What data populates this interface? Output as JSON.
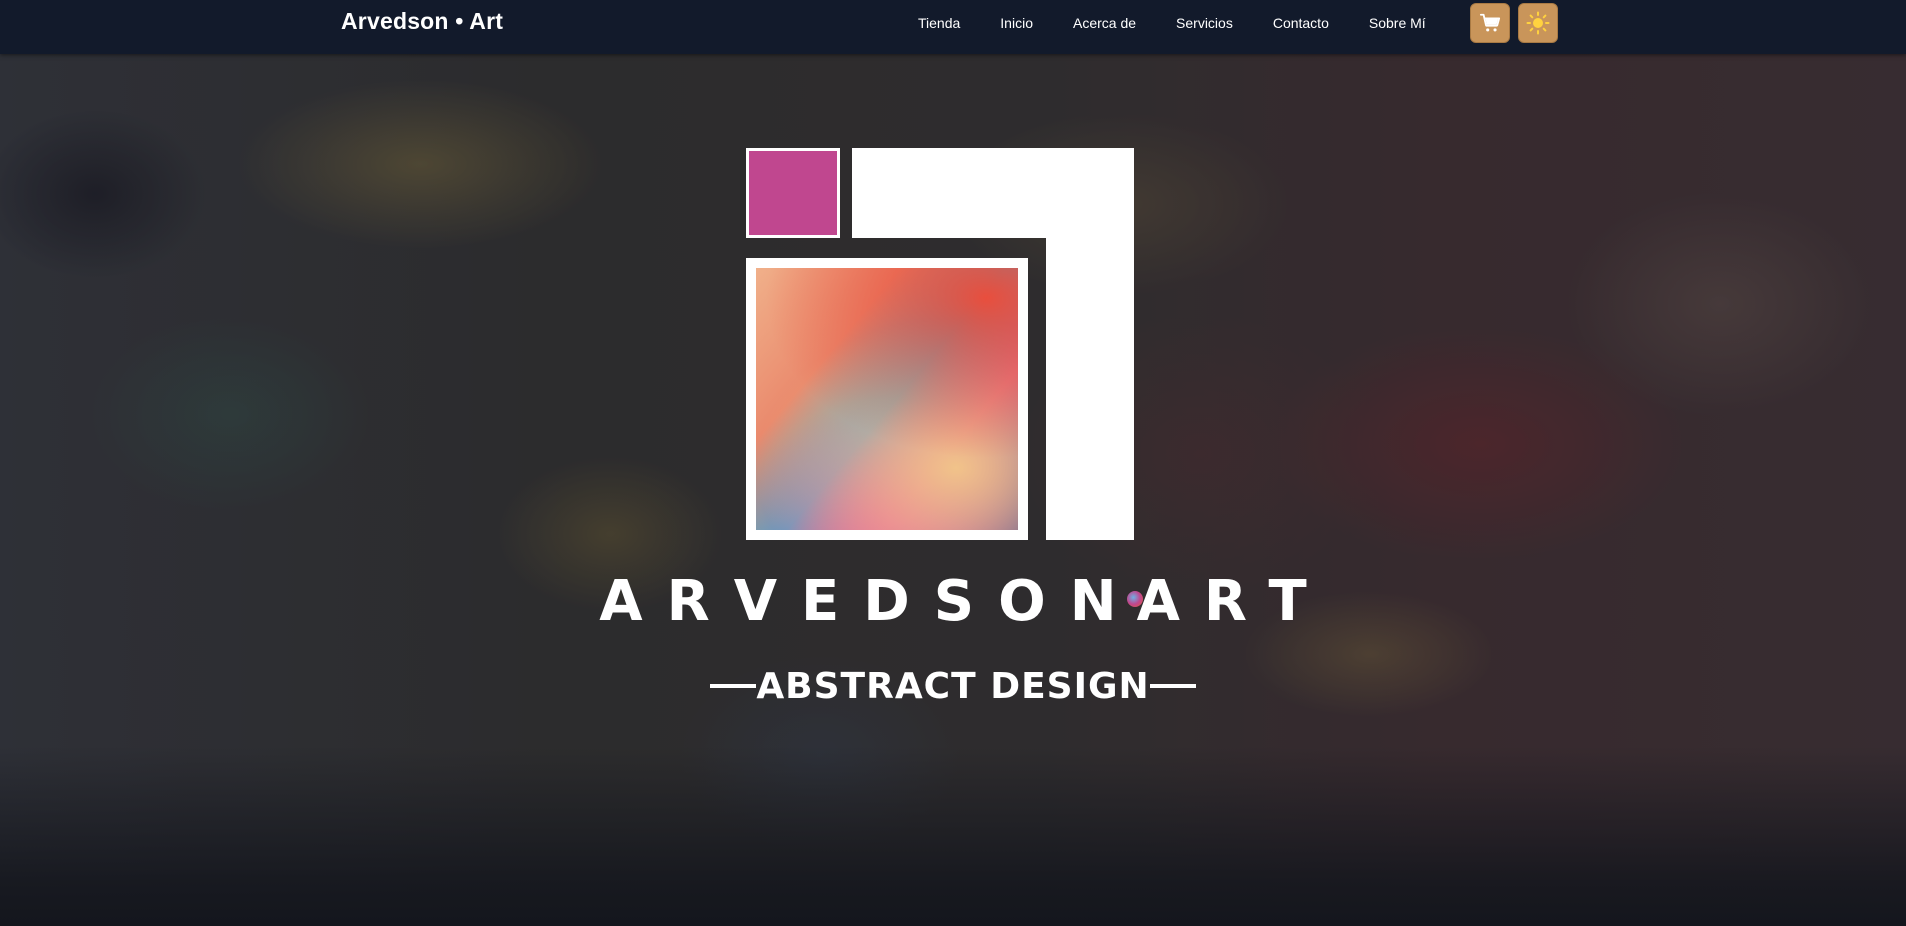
{
  "brand": {
    "name": "Arvedson • Art"
  },
  "nav": {
    "links": [
      {
        "label": "Tienda"
      },
      {
        "label": "Inicio"
      },
      {
        "label": "Acerca de"
      },
      {
        "label": "Servicios"
      },
      {
        "label": "Contacto"
      },
      {
        "label": "Sobre Mí"
      }
    ]
  },
  "buttons": {
    "cart_icon": "cart-icon",
    "theme_icon": "sun-icon"
  },
  "hero": {
    "logo_title_left": "ARVEDSON",
    "logo_title_right": "ART",
    "logo_subtitle": "ABSTRACT DESIGN"
  },
  "colors": {
    "navbar": "#121a2b",
    "accent": "#c9955a",
    "logo_pink": "#c0478f",
    "white": "#ffffff"
  }
}
